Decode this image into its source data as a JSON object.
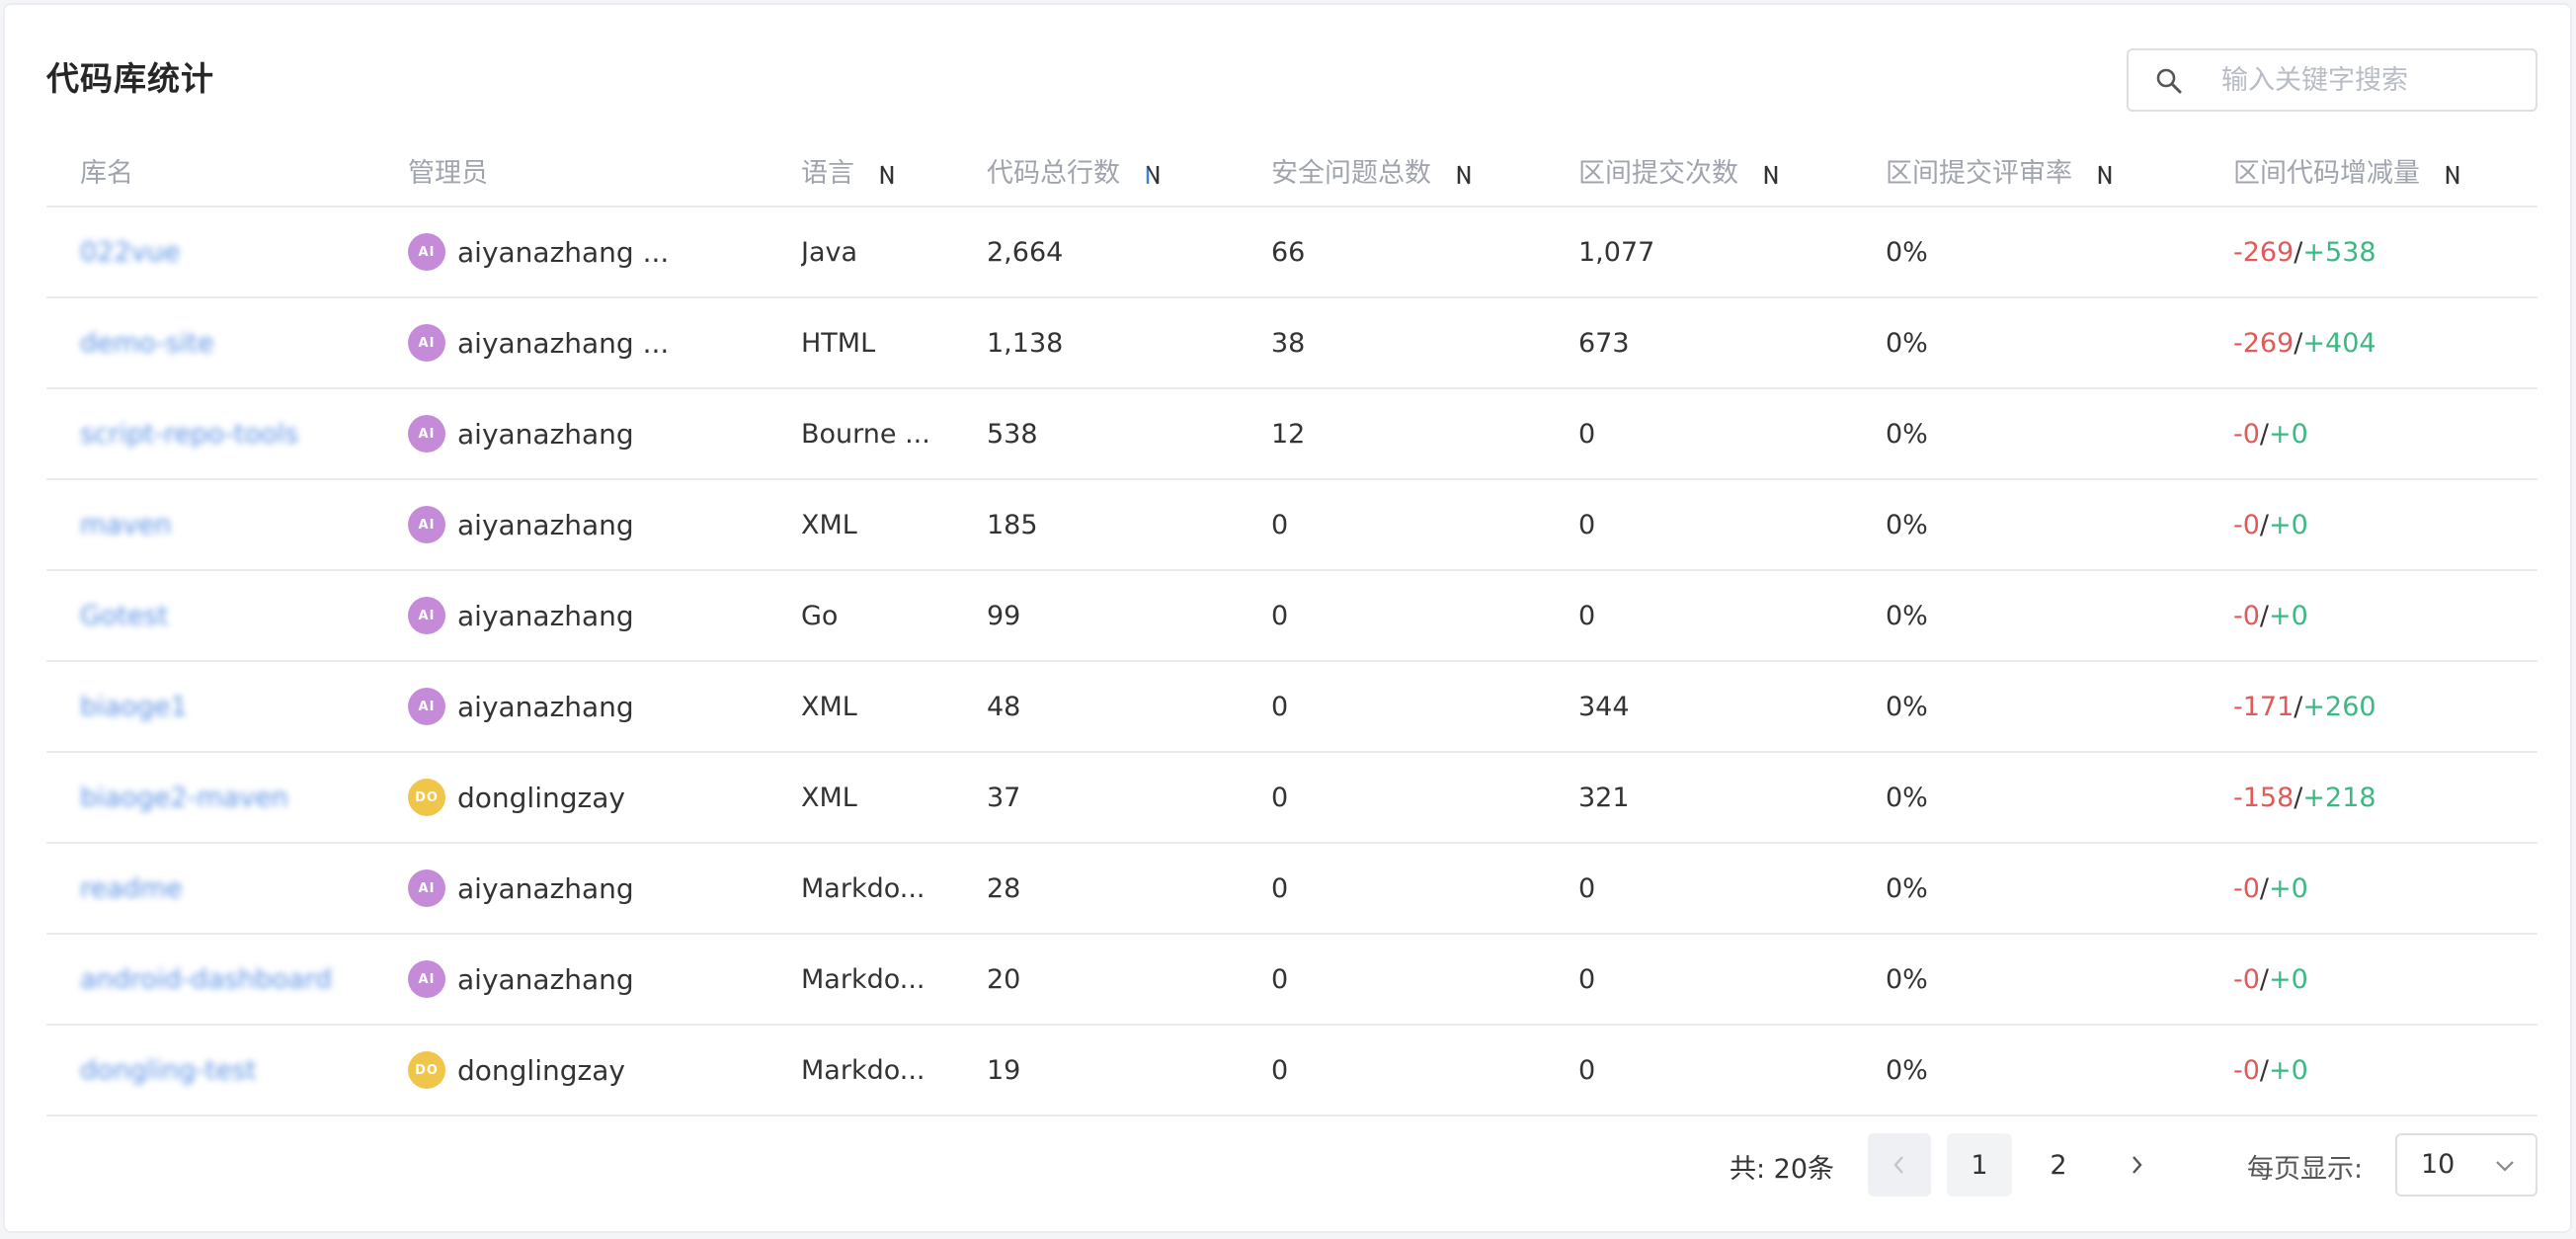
{
  "title": "代码库统计",
  "search": {
    "placeholder": "输入关键字搜索"
  },
  "table": {
    "columns": [
      "库名",
      "管理员",
      "语言",
      "代码总行数",
      "安全问题总数",
      "区间提交次数",
      "区间提交评审率",
      "区间代码增减量"
    ],
    "rows": [
      {
        "name": "022vue",
        "admin": "aiyanazhang ...",
        "avatar": "AI",
        "language": "Java",
        "lines": "2,664",
        "issues": "66",
        "commits": "1,077",
        "review": "0%",
        "minus": "-269",
        "plus": "+538"
      },
      {
        "name": "demo-site",
        "admin": "aiyanazhang ...",
        "avatar": "AI",
        "language": "HTML",
        "lines": "1,138",
        "issues": "38",
        "commits": "673",
        "review": "0%",
        "minus": "-269",
        "plus": "+404"
      },
      {
        "name": "script-repo-tools",
        "admin": "aiyanazhang",
        "avatar": "AI",
        "language": "Bourne ...",
        "lines": "538",
        "issues": "12",
        "commits": "0",
        "review": "0%",
        "minus": "-0",
        "plus": "+0"
      },
      {
        "name": "maven",
        "admin": "aiyanazhang",
        "avatar": "AI",
        "language": "XML",
        "lines": "185",
        "issues": "0",
        "commits": "0",
        "review": "0%",
        "minus": "-0",
        "plus": "+0"
      },
      {
        "name": "Gotest",
        "admin": "aiyanazhang",
        "avatar": "AI",
        "language": "Go",
        "lines": "99",
        "issues": "0",
        "commits": "0",
        "review": "0%",
        "minus": "-0",
        "plus": "+0"
      },
      {
        "name": "biaoge1",
        "admin": "aiyanazhang",
        "avatar": "AI",
        "language": "XML",
        "lines": "48",
        "issues": "0",
        "commits": "344",
        "review": "0%",
        "minus": "-171",
        "plus": "+260"
      },
      {
        "name": "biaoge2-maven",
        "admin": "donglingzay",
        "avatar": "DO",
        "language": "XML",
        "lines": "37",
        "issues": "0",
        "commits": "321",
        "review": "0%",
        "minus": "-158",
        "plus": "+218"
      },
      {
        "name": "readme",
        "admin": "aiyanazhang",
        "avatar": "AI",
        "language": "Markdo...",
        "lines": "28",
        "issues": "0",
        "commits": "0",
        "review": "0%",
        "minus": "-0",
        "plus": "+0"
      },
      {
        "name": "android-dashboard",
        "admin": "aiyanazhang",
        "avatar": "AI",
        "language": "Markdo...",
        "lines": "20",
        "issues": "0",
        "commits": "0",
        "review": "0%",
        "minus": "-0",
        "plus": "+0"
      },
      {
        "name": "dongling-test",
        "admin": "donglingzay",
        "avatar": "DO",
        "language": "Markdo...",
        "lines": "19",
        "issues": "0",
        "commits": "0",
        "review": "0%",
        "minus": "-0",
        "plus": "+0"
      }
    ]
  },
  "pagination": {
    "total": "共: 20条",
    "pages": [
      "1",
      "2"
    ],
    "per_page_label": "每页显示:",
    "per_page_value": "10"
  },
  "colors": {
    "link": "#3f7fe0",
    "minus": "#e05a5a",
    "plus": "#3cb882",
    "avatar_ai": "#c58bd9",
    "avatar_do": "#f0c64a"
  },
  "icons": {
    "search": "search-icon",
    "sort": "sort-icon",
    "prev": "chevron-left-icon",
    "next": "chevron-right-icon",
    "dropdown": "chevron-down-icon"
  }
}
